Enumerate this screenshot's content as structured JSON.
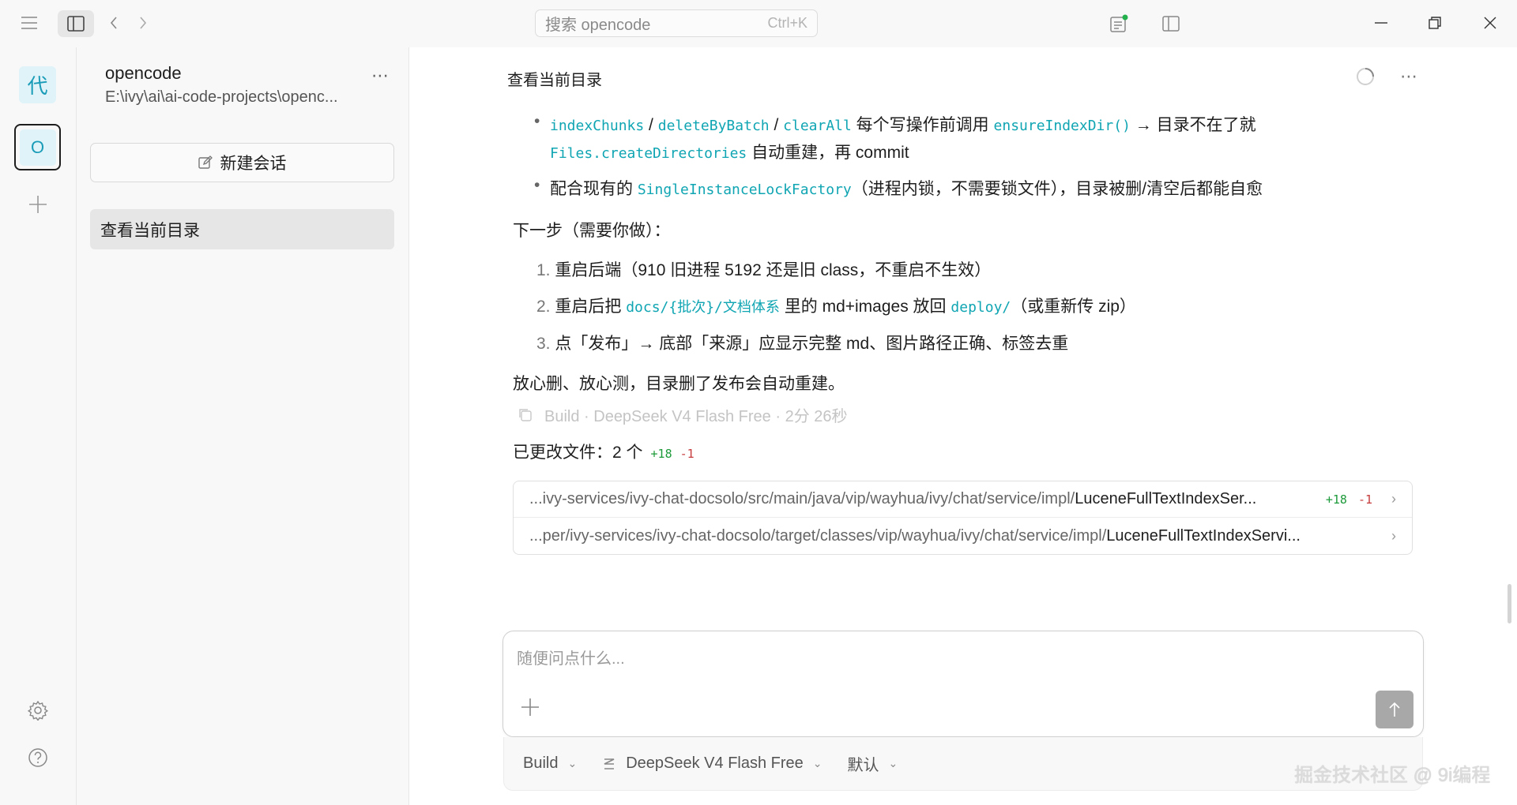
{
  "topbar": {
    "search_placeholder": "搜索 opencode",
    "search_shortcut": "Ctrl+K"
  },
  "rail": {
    "projects": [
      {
        "label": "代"
      },
      {
        "label": "O"
      }
    ]
  },
  "sidebar": {
    "project_name": "opencode",
    "project_path": "E:\\ivy\\ai\\ai-code-projects\\openc...",
    "new_session_label": "新建会话",
    "sessions": [
      {
        "title": "查看当前目录"
      }
    ]
  },
  "conversation": {
    "title": "查看当前目录",
    "bullets": {
      "b1_code1": "indexChunks",
      "b1_sep1": " / ",
      "b1_code2": "deleteByBatch",
      "b1_sep2": " / ",
      "b1_code3": "clearAll",
      "b1_text1": " 每个写操作前调用 ",
      "b1_code4": "ensureIndexDir()",
      "b1_text2": " → 目录不在了就",
      "b1_code5": "Files.createDirectories",
      "b1_text3": " 自动重建，再 commit",
      "b2_text1": "配合现有的 ",
      "b2_code1": "SingleInstanceLockFactory",
      "b2_text2": "（进程内锁，不需要锁文件），目录被删/清空后都能自愈"
    },
    "next_step_heading": "下一步（需要你做）：",
    "steps": {
      "s1_num": "1.",
      "s1_text": "重启后端（910 旧进程 5192 还是旧 class，不重启不生效）",
      "s2_num": "2.",
      "s2_text1": "重启后把 ",
      "s2_code1": "docs/{批次}/文档体系",
      "s2_text2": " 里的 md+images 放回 ",
      "s2_code2": "deploy/",
      "s2_text3": "（或重新传 zip）",
      "s3_num": "3.",
      "s3_text": "点「发布」→ 底部「来源」应显示完整 md、图片路径正确、标签去重"
    },
    "closing": "放心删、放心测，目录删了发布会自动重建。",
    "meta": "Build · DeepSeek V4 Flash Free · 2分 26秒",
    "changes_label": "已更改文件：2 个",
    "changes_add": "+18",
    "changes_del": "-1",
    "files": [
      {
        "dir": "...ivy-services/ivy-chat-docsolo/src/main/java/vip/wayhua/ivy/chat/service/impl/",
        "name": "LuceneFullTextIndexSer...",
        "add": "+18",
        "del": "-1"
      },
      {
        "dir": "...per/ivy-services/ivy-chat-docsolo/target/classes/vip/wayhua/ivy/chat/service/impl/",
        "name": "LuceneFullTextIndexServi...",
        "add": "",
        "del": ""
      }
    ]
  },
  "composer": {
    "placeholder": "随便问点什么...",
    "agent": "Build",
    "model": "DeepSeek V4 Flash Free",
    "variant": "默认"
  },
  "watermark": "掘金技术社区 @ 9i编程",
  "colors": {
    "accent_code": "#10a5b3",
    "add": "#1d9a3a",
    "del": "#c63c3c",
    "project_bg": "#dff3f8"
  }
}
